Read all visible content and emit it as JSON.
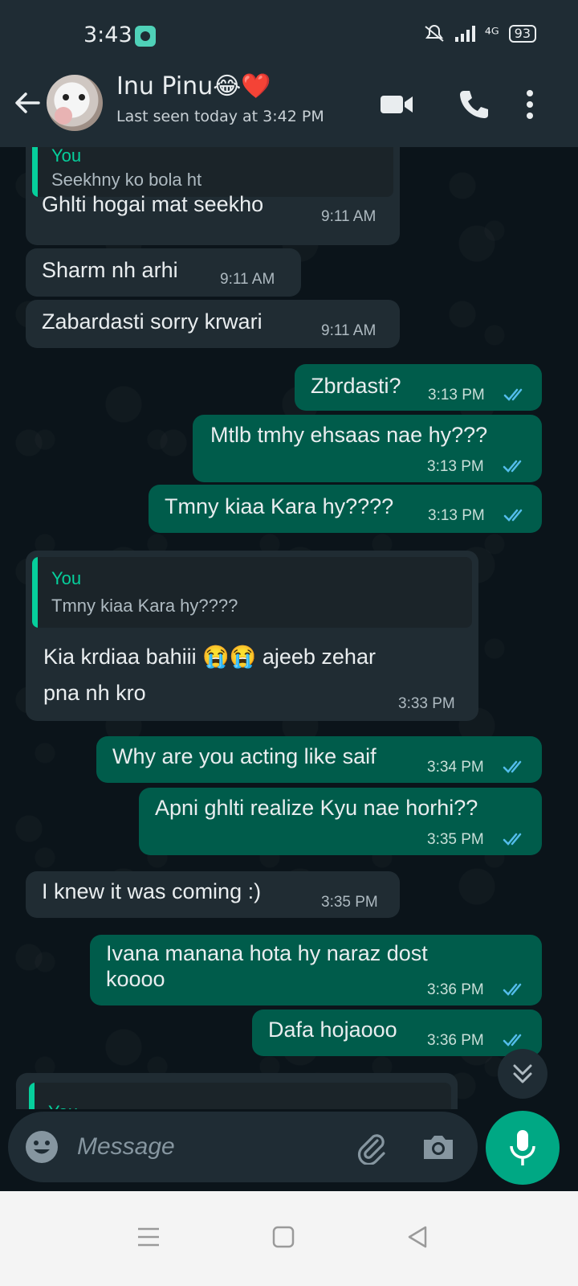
{
  "status_bar": {
    "time": "3:43",
    "network": "⁴ᴳ",
    "battery": "93"
  },
  "header": {
    "contact_name": "Inu Pinu😂❤️",
    "last_seen": "Last seen today at 3:42 PM"
  },
  "messages": [
    {
      "direction": "in",
      "quote_author": "You",
      "quote_text": "Seekhny ko bola ht",
      "text": "Ghlti hogai mat seekho",
      "time": "9:11 AM"
    },
    {
      "direction": "in",
      "text": "Sharm nh arhi",
      "time": "9:11 AM"
    },
    {
      "direction": "in",
      "text": "Zabardasti sorry krwari",
      "time": "9:11 AM"
    },
    {
      "direction": "out",
      "text": "Zbrdasti?",
      "time": "3:13 PM"
    },
    {
      "direction": "out",
      "text": "Mtlb tmhy ehsaas nae hy???",
      "time": "3:13 PM"
    },
    {
      "direction": "out",
      "text": "Tmny kiaa Kara hy????",
      "time": "3:13 PM"
    },
    {
      "direction": "in",
      "quote_author": "You",
      "quote_text": "Tmny kiaa Kara hy????",
      "text_line1": "Kia krdiaa bahiii 😭😭 ajeeb zehar",
      "text_line2": "pna nh kro",
      "time": "3:33 PM"
    },
    {
      "direction": "out",
      "text": "Why are you acting like saif",
      "time": "3:34 PM"
    },
    {
      "direction": "out",
      "text": "Apni ghlti realize Kyu nae horhi??",
      "time": "3:35 PM"
    },
    {
      "direction": "in",
      "text": "I knew it was coming :)",
      "time": "3:35 PM"
    },
    {
      "direction": "out",
      "text_line1": "Ivana manana hota hy naraz dost",
      "text_line2": "koooo",
      "time": "3:36 PM"
    },
    {
      "direction": "out",
      "text": "Dafa hojaooo",
      "time": "3:36 PM"
    },
    {
      "direction": "in",
      "quote_author": "You"
    }
  ],
  "input": {
    "placeholder": "Message"
  },
  "colors": {
    "incoming_bubble": "#202c33",
    "outgoing_bubble": "#005c4b",
    "accent": "#00a884",
    "read_ticks": "#53bdeb"
  },
  "icons": [
    "back-arrow-icon",
    "video-icon",
    "phone-icon",
    "more-vertical-icon",
    "double-chevron-down-icon",
    "emoji-icon",
    "attach-icon",
    "camera-icon",
    "mic-icon",
    "menu-icon",
    "home-icon",
    "back-icon"
  ]
}
